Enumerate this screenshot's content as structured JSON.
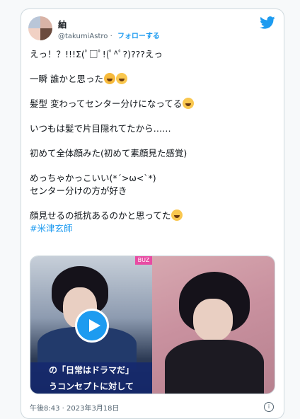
{
  "user": {
    "name": "紬",
    "handle": "@takumiAstro",
    "follow_label": "フォローする"
  },
  "tweet": {
    "lines": [
      "えっ！？!!!Σ(ﾟ□ﾟ!(ﾟ^ﾟ?)???えっ",
      "一瞬 誰かと思った",
      "髪型 変わってセンター分けになってる",
      "いつもは髪で片目隠れてたから……",
      "初めて全体顔みた(初めて素顔見た感覚)",
      "めっちゃかっこいい(*´>ω<`*)",
      "センター分けの方が好き",
      "顔見せるの抵抗あるのかと思ってた"
    ],
    "hashtag": "#米津玄師"
  },
  "media": {
    "caption_line1": "の「日常はドラマだ」",
    "caption_line2": "うコンセプトに対して",
    "corner_tag": "BUZ"
  },
  "timestamp": "午後8:43 · 2023年3月18日",
  "icons": {
    "bird": "twitter-bird-icon",
    "play": "play-icon",
    "info": "info-icon"
  },
  "colors": {
    "accent": "#1d9bf0",
    "text": "#0f1419",
    "muted": "#536471"
  }
}
